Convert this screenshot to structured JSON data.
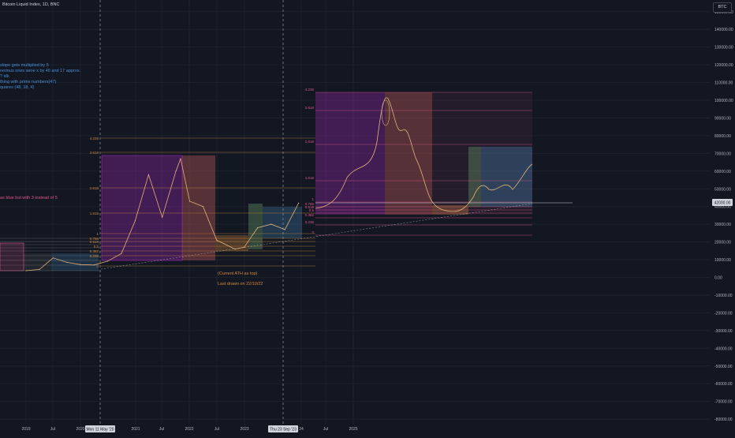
{
  "header": {
    "title": "Bitcoin Liquid Index, 1D, BNC",
    "symbol": "BTC"
  },
  "notes": [
    "slope gets multiplied by 5",
    "revious ones were x by 46 and 17 approx.",
    "? idk",
    "thing with prime numbers(47)",
    "quares (48, 18, 4)"
  ],
  "pink_note": "as blue but with 3 instead of 5",
  "annotations": {
    "ath_note": "(Current ATH as top)",
    "drawn_note": "Last drawn on 22/10/22"
  },
  "colors": {
    "background": "#131722",
    "price_line": "#e0b27a",
    "fib_orange": "#d68a3a",
    "fib_pink": "#e0558a",
    "purple_box": "#9c27b0",
    "red_box": "#f26c6c",
    "blue_box": "#4a90c2",
    "green_box": "#7cb87c"
  },
  "chart_data": {
    "type": "line",
    "title": "Bitcoin Liquid Index, 1D, BNC",
    "y_axis": {
      "ylim": [
        -80000,
        150000
      ],
      "ticks": [
        150000,
        140000,
        130000,
        120000,
        110000,
        100000,
        90000,
        80000,
        70000,
        60000,
        50000,
        40000,
        30000,
        20000,
        10000,
        0,
        -10000,
        -20000,
        -30000,
        -40000,
        -50000,
        -60000,
        -70000,
        -80000
      ]
    },
    "x_axis": {
      "tick_labels": [
        "2019",
        "Jul",
        "2020",
        "2021",
        "Jul",
        "2022",
        "Jul",
        "2023",
        "24",
        "Jul",
        "2025"
      ],
      "cursor_labels": [
        "Mon 11 May '20",
        "Thu 23 Sep '23"
      ]
    },
    "last_price_label": "42000.00",
    "series": [
      {
        "x": [
          "2019-01",
          "2019-04",
          "2019-07",
          "2019-10",
          "2020-01",
          "2020-04",
          "2020-07",
          "2020-10",
          "2021-01",
          "2021-04",
          "2021-07",
          "2021-10",
          "2021-11",
          "2022-01",
          "2022-04",
          "2022-07",
          "2022-11",
          "2023-01",
          "2023-04",
          "2023-07",
          "2023-10",
          "2024-01"
        ],
        "y": [
          3800,
          4500,
          11000,
          8500,
          7200,
          7000,
          9200,
          13500,
          32000,
          58000,
          34000,
          60000,
          67000,
          43000,
          40000,
          21000,
          16000,
          17000,
          28000,
          30000,
          27000,
          42000
        ]
      }
    ],
    "fib_levels_left": [
      "4.236",
      "3.618",
      "2.618",
      "1.618",
      "1",
      "0.786",
      "0.618",
      "0.5",
      "0.382",
      "0.236",
      "0"
    ],
    "fib_levels_right": [
      "4.236",
      "3.618",
      "2.618",
      "1.618",
      "1",
      "0.786",
      "0.618",
      "0.5",
      "0.382",
      "0.236",
      "0"
    ],
    "grid": true
  }
}
